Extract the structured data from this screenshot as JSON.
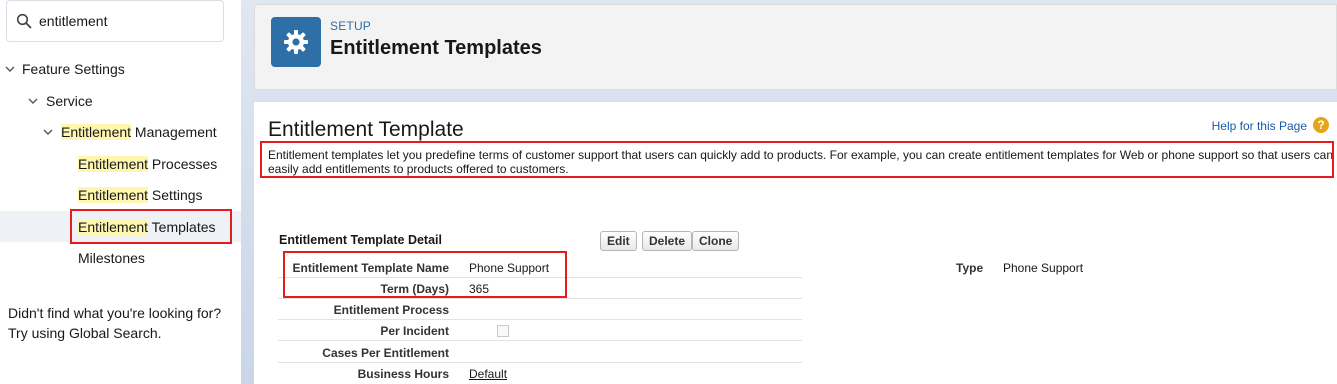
{
  "search": {
    "value": "entitlement",
    "icon": "search-icon"
  },
  "sidebar": {
    "items": [
      {
        "label": "Feature Settings",
        "level": 0,
        "expanded": true
      },
      {
        "label": "Service",
        "level": 1,
        "expanded": true
      },
      {
        "highlight": "Entitlement",
        "rest": " Management",
        "level": 2,
        "expanded": true
      },
      {
        "highlight": "Entitlement",
        "rest": " Processes",
        "level": 3
      },
      {
        "highlight": "Entitlement",
        "rest": " Settings",
        "level": 3
      },
      {
        "highlight": "Entitlement",
        "rest": " Templates",
        "level": 3,
        "selected": true
      },
      {
        "label": "Milestones",
        "level": 3
      }
    ],
    "help_line1": "Didn't find what you're looking for?",
    "help_line2_prefix": "Try using ",
    "help_line2_link": "Global Search",
    "help_line2_suffix": "."
  },
  "header": {
    "breadcrumb": "SETUP",
    "title": "Entitlement Templates",
    "icon": "gear-icon",
    "icon_bg": "#2e6fa8"
  },
  "content": {
    "title": "Entitlement Template",
    "help_link": "Help for this Page",
    "description": "Entitlement templates let you predefine terms of customer support that users can quickly add to products. For example, you can create entitlement templates for Web or phone support so that users can easily add entitlements to products offered to customers.",
    "detail_title": "Entitlement Template Detail",
    "buttons": {
      "edit": "Edit",
      "delete": "Delete",
      "clone": "Clone"
    },
    "fields": [
      {
        "label": "Entitlement Template Name",
        "value": "Phone Support"
      },
      {
        "label": "Term (Days)",
        "value": "365"
      },
      {
        "label": "Entitlement Process",
        "value": ""
      },
      {
        "label": "Per Incident",
        "checked": false
      },
      {
        "label": "Cases Per Entitlement",
        "value": ""
      },
      {
        "label": "Business Hours",
        "value": "Default"
      }
    ],
    "type_label": "Type",
    "type_value": "Phone Support"
  },
  "colors": {
    "accent": "#2e6fa8",
    "highlight": "#fff7b0",
    "annotation": "#e21d1d"
  }
}
